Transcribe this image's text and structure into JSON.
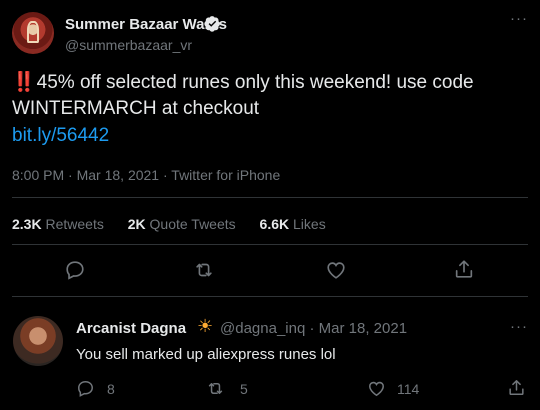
{
  "tweet": {
    "display_name": "Summer Bazaar Wares",
    "handle": "@summerbazaar_vr",
    "more": "···",
    "emoji": "‼️",
    "text": "45% off selected runes only this weekend! use code WINTERMARCH at checkout",
    "link": "bit.ly/56442",
    "time": "8:00 PM",
    "date": "Mar 18, 2021",
    "source": "Twitter for iPhone",
    "separator": "·",
    "stats": {
      "retweets_count": "2.3K",
      "retweets_label": "Retweets",
      "quotes_count": "2K",
      "quotes_label": "Quote Tweets",
      "likes_count": "6.6K",
      "likes_label": "Likes"
    },
    "actions": [
      "reply-icon",
      "retweet-icon",
      "like-icon",
      "share-icon"
    ]
  },
  "reply": {
    "display_name": "Arcanist Dagna",
    "emoji": "☀",
    "handle": "@dagna_inq",
    "date": "Mar 18, 2021",
    "separator": "·",
    "more": "···",
    "text": "You sell marked up aliexpress runes lol",
    "reply_count": "8",
    "retweet_count": "5",
    "like_count": "114"
  },
  "colors": {
    "background": "#000000",
    "text": "#e7e9ea",
    "secondary": "#71767b",
    "link": "#1d9bf0",
    "divider": "#2f3336",
    "exclamation": "#e0245e"
  }
}
